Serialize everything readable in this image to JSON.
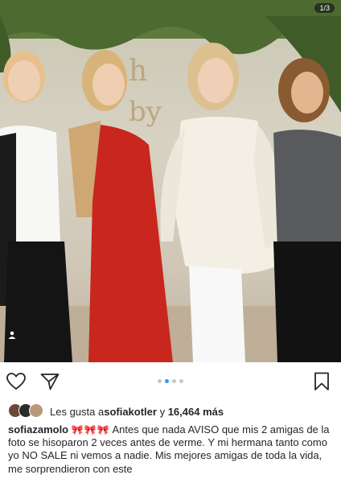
{
  "post": {
    "carousel_counter": "1/3",
    "photo_description_icon": "person-tag-icon",
    "carousel_dots": {
      "count": 4,
      "active_index": 1
    }
  },
  "actions": {
    "like_icon": "heart-outline-icon",
    "share_icon": "send-icon",
    "save_icon": "bookmark-icon"
  },
  "likes": {
    "prefix": "Les gusta a ",
    "user": "sofiakotler",
    "connector": " y ",
    "count": "16,464 más"
  },
  "caption": {
    "username": "sofiazamolo",
    "emojis": "🎀🎀🎀",
    "text": " Antes que nada AVISO que mis 2 amigas de la foto se hisoparon 2 veces antes de verme. Y mi hermana tanto como yo NO SALE ni vemos a nadie. Mis mejores amigas de toda la vida, me sorprendieron con este"
  },
  "colors": {
    "accent_blue": "#3897f0",
    "text": "#262626",
    "dot_inactive": "#c7c7c7"
  }
}
